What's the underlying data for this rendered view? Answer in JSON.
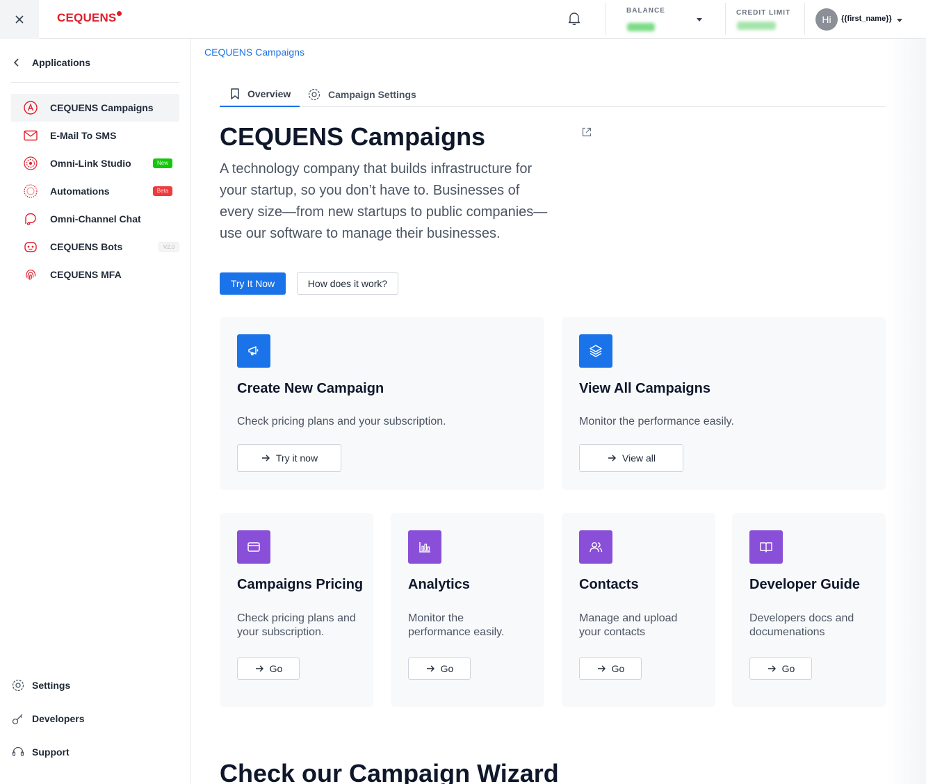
{
  "header": {
    "logo": "CEQUENS",
    "balance_label": "BALANCE",
    "credit_label": "CREDIT LIMIT",
    "avatar_initials": "Hi",
    "username": "{{first_name}}"
  },
  "sidebar": {
    "back_label": "Applications",
    "items": [
      {
        "label": "CEQUENS Campaigns",
        "icon": "campaigns-icon"
      },
      {
        "label": "E-Mail To SMS",
        "icon": "mail-icon"
      },
      {
        "label": "Omni-Link Studio",
        "icon": "omni-link-icon",
        "badge": "New"
      },
      {
        "label": "Automations",
        "icon": "automations-icon",
        "badge": "Beta"
      },
      {
        "label": "Omni-Channel Chat",
        "icon": "chat-icon"
      },
      {
        "label": "CEQUENS Bots",
        "icon": "bot-icon",
        "badge": "V2.0"
      },
      {
        "label": "CEQUENS MFA",
        "icon": "fingerprint-icon"
      }
    ],
    "footer": [
      {
        "label": "Settings",
        "icon": "gear-icon"
      },
      {
        "label": "Developers",
        "icon": "key-icon"
      },
      {
        "label": "Support",
        "icon": "headset-icon"
      }
    ]
  },
  "main": {
    "breadcrumb": "CEQUENS Campaigns",
    "tabs": [
      {
        "label": "Overview"
      },
      {
        "label": "Campaign Settings"
      }
    ],
    "title": "CEQUENS Campaigns",
    "lead": "A technology company that builds infrastructure for your startup, so you don’t have to. Businesses of every size—from new startups to public companies—use our software to manage their businesses.",
    "primary_button": "Try It Now",
    "secondary_button": "How does it work?",
    "big_cards": [
      {
        "title": "Create New Campaign",
        "desc": "Check pricing plans and your subscription.",
        "button": "Try it now"
      },
      {
        "title": "View All Campaigns",
        "desc": "Monitor the performance easily.",
        "button": "View all"
      }
    ],
    "small_cards": [
      {
        "title": "Campaigns Pricing",
        "desc": "Check pricing plans and your subscription.",
        "button": "Go"
      },
      {
        "title": "Analytics",
        "desc": "Monitor the performance easily.",
        "button": "Go"
      },
      {
        "title": "Contacts",
        "desc": "Manage and upload your contacts",
        "button": "Go"
      },
      {
        "title": "Developer Guide",
        "desc": "Developers docs and documenations",
        "button": "Go"
      }
    ],
    "wizard_title": "Check our Campaign Wizard"
  },
  "colors": {
    "accent": "#1a73e8",
    "brand": "#e11d2a",
    "card_purple": "#8a4fd8"
  }
}
